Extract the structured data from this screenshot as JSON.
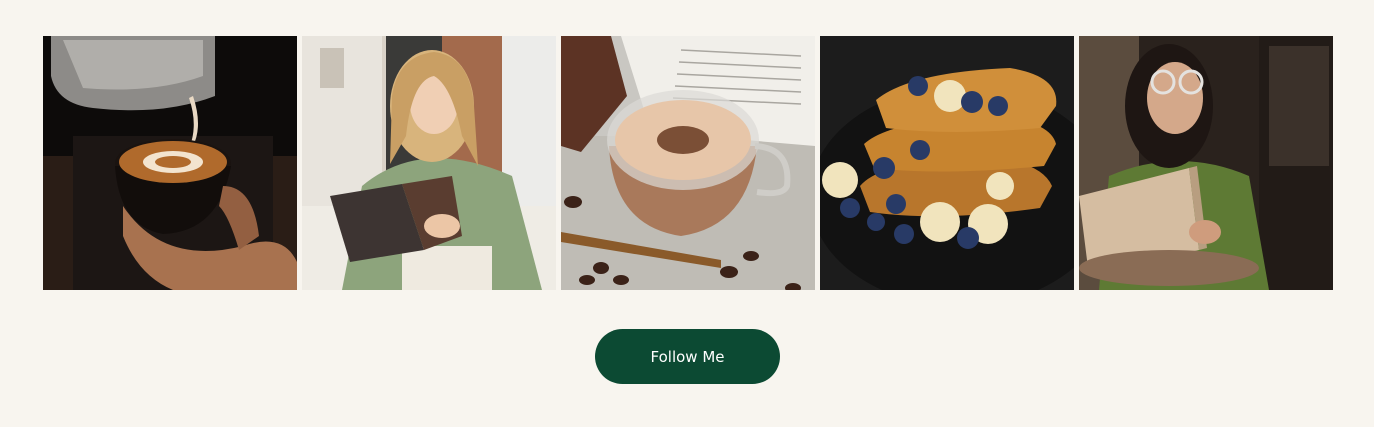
{
  "gallery": {
    "images": [
      {
        "name": "latte-art-pour"
      },
      {
        "name": "woman-reading-book"
      },
      {
        "name": "hot-chocolate-cup"
      },
      {
        "name": "french-toast-blueberries"
      },
      {
        "name": "woman-with-glasses-reading"
      }
    ]
  },
  "follow_button": {
    "label": "Follow Me"
  },
  "colors": {
    "background": "#f8f5ef",
    "button": "#0c4a33",
    "button_text": "#ffffff"
  }
}
